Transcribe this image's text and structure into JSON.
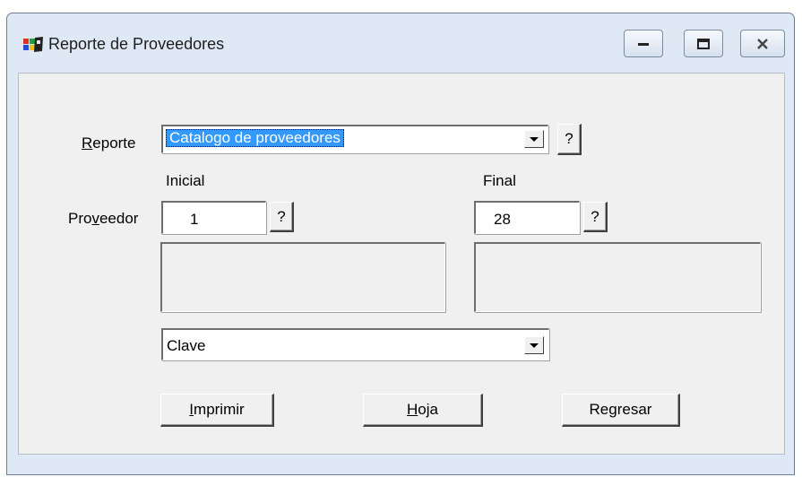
{
  "window": {
    "title": "Reporte de Proveedores"
  },
  "controls": {
    "minimize": "minimize-icon",
    "maximize": "maximize-icon",
    "close": "close-icon"
  },
  "reporte": {
    "label_pre": "",
    "label_u": "R",
    "label_post": "eporte",
    "selected": "Catalogo de proveedores",
    "help": "?"
  },
  "proveedor": {
    "label_pre": "Pro",
    "label_u": "v",
    "label_post": "eedor",
    "inicial_label": "Inicial",
    "final_label": "Final",
    "inicial_value": "1",
    "final_value": "28",
    "help": "?"
  },
  "orden": {
    "selected": "Clave"
  },
  "buttons": {
    "imprimir_u": "I",
    "imprimir_rest": "mprimir",
    "hoja_u": "H",
    "hoja_rest": "oja",
    "regresar": "Regresar"
  }
}
